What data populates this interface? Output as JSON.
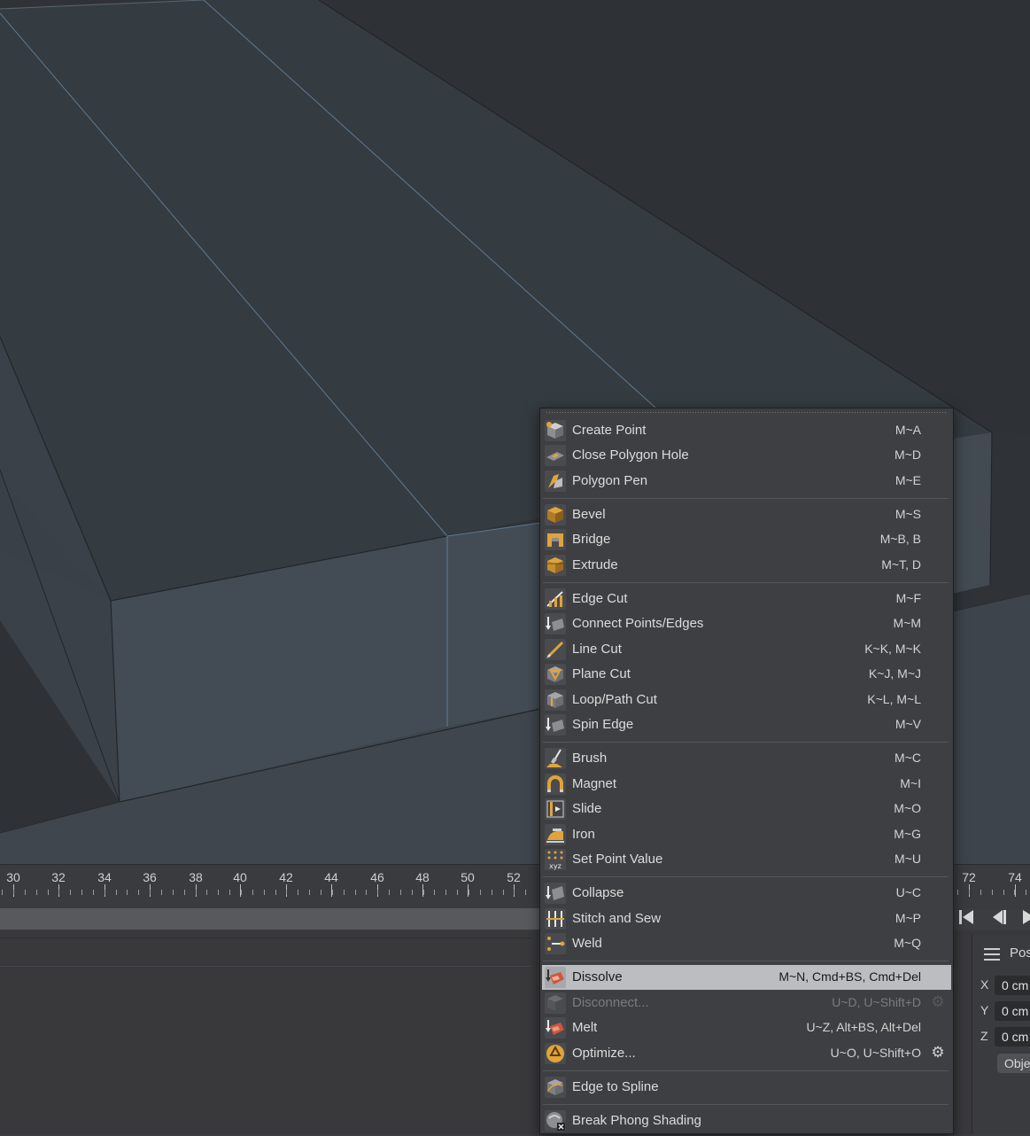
{
  "timeline": {
    "labels": [
      "30",
      "32",
      "34",
      "36",
      "38",
      "40",
      "42",
      "44",
      "46",
      "48",
      "50",
      "52",
      "72",
      "74"
    ]
  },
  "attributes": {
    "header": "Pos",
    "rows": [
      {
        "axis": "X",
        "value": "0 cm"
      },
      {
        "axis": "Y",
        "value": "0 cm"
      },
      {
        "axis": "Z",
        "value": "0 cm"
      }
    ],
    "object_button": "Obje"
  },
  "menu": {
    "items": [
      {
        "label": "Create Point",
        "shortcut": "M~A",
        "icon": "create-point-icon"
      },
      {
        "label": "Close Polygon Hole",
        "shortcut": "M~D",
        "icon": "close-polygon-hole-icon"
      },
      {
        "label": "Polygon Pen",
        "shortcut": "M~E",
        "icon": "polygon-pen-icon"
      },
      {
        "label": "Bevel",
        "shortcut": "M~S",
        "icon": "bevel-icon"
      },
      {
        "label": "Bridge",
        "shortcut": "M~B, B",
        "icon": "bridge-icon"
      },
      {
        "label": "Extrude",
        "shortcut": "M~T, D",
        "icon": "extrude-icon"
      },
      {
        "label": "Edge Cut",
        "shortcut": "M~F",
        "icon": "edge-cut-icon"
      },
      {
        "label": "Connect Points/Edges",
        "shortcut": "M~M",
        "icon": "connect-points-edges-icon"
      },
      {
        "label": "Line Cut",
        "shortcut": "K~K, M~K",
        "icon": "line-cut-icon"
      },
      {
        "label": "Plane Cut",
        "shortcut": "K~J, M~J",
        "icon": "plane-cut-icon"
      },
      {
        "label": "Loop/Path Cut",
        "shortcut": "K~L, M~L",
        "icon": "loop-path-cut-icon"
      },
      {
        "label": "Spin Edge",
        "shortcut": "M~V",
        "icon": "spin-edge-icon"
      },
      {
        "label": "Brush",
        "shortcut": "M~C",
        "icon": "brush-icon"
      },
      {
        "label": "Magnet",
        "shortcut": "M~I",
        "icon": "magnet-icon"
      },
      {
        "label": "Slide",
        "shortcut": "M~O",
        "icon": "slide-icon"
      },
      {
        "label": "Iron",
        "shortcut": "M~G",
        "icon": "iron-icon"
      },
      {
        "label": "Set Point Value",
        "shortcut": "M~U",
        "icon": "set-point-value-icon"
      },
      {
        "label": "Collapse",
        "shortcut": "U~C",
        "icon": "collapse-icon"
      },
      {
        "label": "Stitch and Sew",
        "shortcut": "M~P",
        "icon": "stitch-and-sew-icon"
      },
      {
        "label": "Weld",
        "shortcut": "M~Q",
        "icon": "weld-icon"
      },
      {
        "label": "Dissolve",
        "shortcut": "M~N, Cmd+BS, Cmd+Del",
        "icon": "dissolve-icon",
        "state": "highlighted"
      },
      {
        "label": "Disconnect...",
        "shortcut": "U~D, U~Shift+D",
        "icon": "disconnect-icon",
        "state": "disabled"
      },
      {
        "label": "Melt",
        "shortcut": "U~Z, Alt+BS, Alt+Del",
        "icon": "melt-icon"
      },
      {
        "label": "Optimize...",
        "shortcut": "U~O, U~Shift+O",
        "icon": "optimize-icon"
      },
      {
        "label": "Edge to Spline",
        "shortcut": "",
        "icon": "edge-to-spline-icon"
      },
      {
        "label": "Break Phong Shading",
        "shortcut": "",
        "icon": "break-phong-shading-icon"
      }
    ]
  },
  "colors": {
    "viewport_background": "#2f3336",
    "mesh_face": "#3f464d",
    "selected_edge": "#6e8ba3",
    "menu_background": "#3e3f42",
    "menu_highlight": "#bcbdc0",
    "icon_accent": "#e0a43a"
  }
}
